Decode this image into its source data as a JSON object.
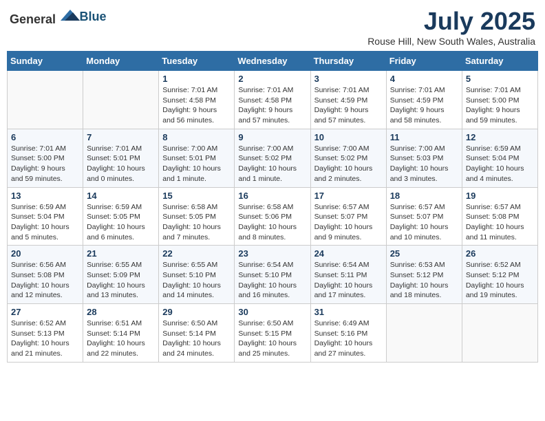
{
  "header": {
    "logo_general": "General",
    "logo_blue": "Blue",
    "title": "July 2025",
    "subtitle": "Rouse Hill, New South Wales, Australia"
  },
  "weekdays": [
    "Sunday",
    "Monday",
    "Tuesday",
    "Wednesday",
    "Thursday",
    "Friday",
    "Saturday"
  ],
  "weeks": [
    [
      {
        "day": "",
        "info": ""
      },
      {
        "day": "",
        "info": ""
      },
      {
        "day": "1",
        "info": "Sunrise: 7:01 AM\nSunset: 4:58 PM\nDaylight: 9 hours\nand 56 minutes."
      },
      {
        "day": "2",
        "info": "Sunrise: 7:01 AM\nSunset: 4:58 PM\nDaylight: 9 hours\nand 57 minutes."
      },
      {
        "day": "3",
        "info": "Sunrise: 7:01 AM\nSunset: 4:59 PM\nDaylight: 9 hours\nand 57 minutes."
      },
      {
        "day": "4",
        "info": "Sunrise: 7:01 AM\nSunset: 4:59 PM\nDaylight: 9 hours\nand 58 minutes."
      },
      {
        "day": "5",
        "info": "Sunrise: 7:01 AM\nSunset: 5:00 PM\nDaylight: 9 hours\nand 59 minutes."
      }
    ],
    [
      {
        "day": "6",
        "info": "Sunrise: 7:01 AM\nSunset: 5:00 PM\nDaylight: 9 hours\nand 59 minutes."
      },
      {
        "day": "7",
        "info": "Sunrise: 7:01 AM\nSunset: 5:01 PM\nDaylight: 10 hours\nand 0 minutes."
      },
      {
        "day": "8",
        "info": "Sunrise: 7:00 AM\nSunset: 5:01 PM\nDaylight: 10 hours\nand 1 minute."
      },
      {
        "day": "9",
        "info": "Sunrise: 7:00 AM\nSunset: 5:02 PM\nDaylight: 10 hours\nand 1 minute."
      },
      {
        "day": "10",
        "info": "Sunrise: 7:00 AM\nSunset: 5:02 PM\nDaylight: 10 hours\nand 2 minutes."
      },
      {
        "day": "11",
        "info": "Sunrise: 7:00 AM\nSunset: 5:03 PM\nDaylight: 10 hours\nand 3 minutes."
      },
      {
        "day": "12",
        "info": "Sunrise: 6:59 AM\nSunset: 5:04 PM\nDaylight: 10 hours\nand 4 minutes."
      }
    ],
    [
      {
        "day": "13",
        "info": "Sunrise: 6:59 AM\nSunset: 5:04 PM\nDaylight: 10 hours\nand 5 minutes."
      },
      {
        "day": "14",
        "info": "Sunrise: 6:59 AM\nSunset: 5:05 PM\nDaylight: 10 hours\nand 6 minutes."
      },
      {
        "day": "15",
        "info": "Sunrise: 6:58 AM\nSunset: 5:05 PM\nDaylight: 10 hours\nand 7 minutes."
      },
      {
        "day": "16",
        "info": "Sunrise: 6:58 AM\nSunset: 5:06 PM\nDaylight: 10 hours\nand 8 minutes."
      },
      {
        "day": "17",
        "info": "Sunrise: 6:57 AM\nSunset: 5:07 PM\nDaylight: 10 hours\nand 9 minutes."
      },
      {
        "day": "18",
        "info": "Sunrise: 6:57 AM\nSunset: 5:07 PM\nDaylight: 10 hours\nand 10 minutes."
      },
      {
        "day": "19",
        "info": "Sunrise: 6:57 AM\nSunset: 5:08 PM\nDaylight: 10 hours\nand 11 minutes."
      }
    ],
    [
      {
        "day": "20",
        "info": "Sunrise: 6:56 AM\nSunset: 5:08 PM\nDaylight: 10 hours\nand 12 minutes."
      },
      {
        "day": "21",
        "info": "Sunrise: 6:55 AM\nSunset: 5:09 PM\nDaylight: 10 hours\nand 13 minutes."
      },
      {
        "day": "22",
        "info": "Sunrise: 6:55 AM\nSunset: 5:10 PM\nDaylight: 10 hours\nand 14 minutes."
      },
      {
        "day": "23",
        "info": "Sunrise: 6:54 AM\nSunset: 5:10 PM\nDaylight: 10 hours\nand 16 minutes."
      },
      {
        "day": "24",
        "info": "Sunrise: 6:54 AM\nSunset: 5:11 PM\nDaylight: 10 hours\nand 17 minutes."
      },
      {
        "day": "25",
        "info": "Sunrise: 6:53 AM\nSunset: 5:12 PM\nDaylight: 10 hours\nand 18 minutes."
      },
      {
        "day": "26",
        "info": "Sunrise: 6:52 AM\nSunset: 5:12 PM\nDaylight: 10 hours\nand 19 minutes."
      }
    ],
    [
      {
        "day": "27",
        "info": "Sunrise: 6:52 AM\nSunset: 5:13 PM\nDaylight: 10 hours\nand 21 minutes."
      },
      {
        "day": "28",
        "info": "Sunrise: 6:51 AM\nSunset: 5:14 PM\nDaylight: 10 hours\nand 22 minutes."
      },
      {
        "day": "29",
        "info": "Sunrise: 6:50 AM\nSunset: 5:14 PM\nDaylight: 10 hours\nand 24 minutes."
      },
      {
        "day": "30",
        "info": "Sunrise: 6:50 AM\nSunset: 5:15 PM\nDaylight: 10 hours\nand 25 minutes."
      },
      {
        "day": "31",
        "info": "Sunrise: 6:49 AM\nSunset: 5:16 PM\nDaylight: 10 hours\nand 27 minutes."
      },
      {
        "day": "",
        "info": ""
      },
      {
        "day": "",
        "info": ""
      }
    ]
  ]
}
